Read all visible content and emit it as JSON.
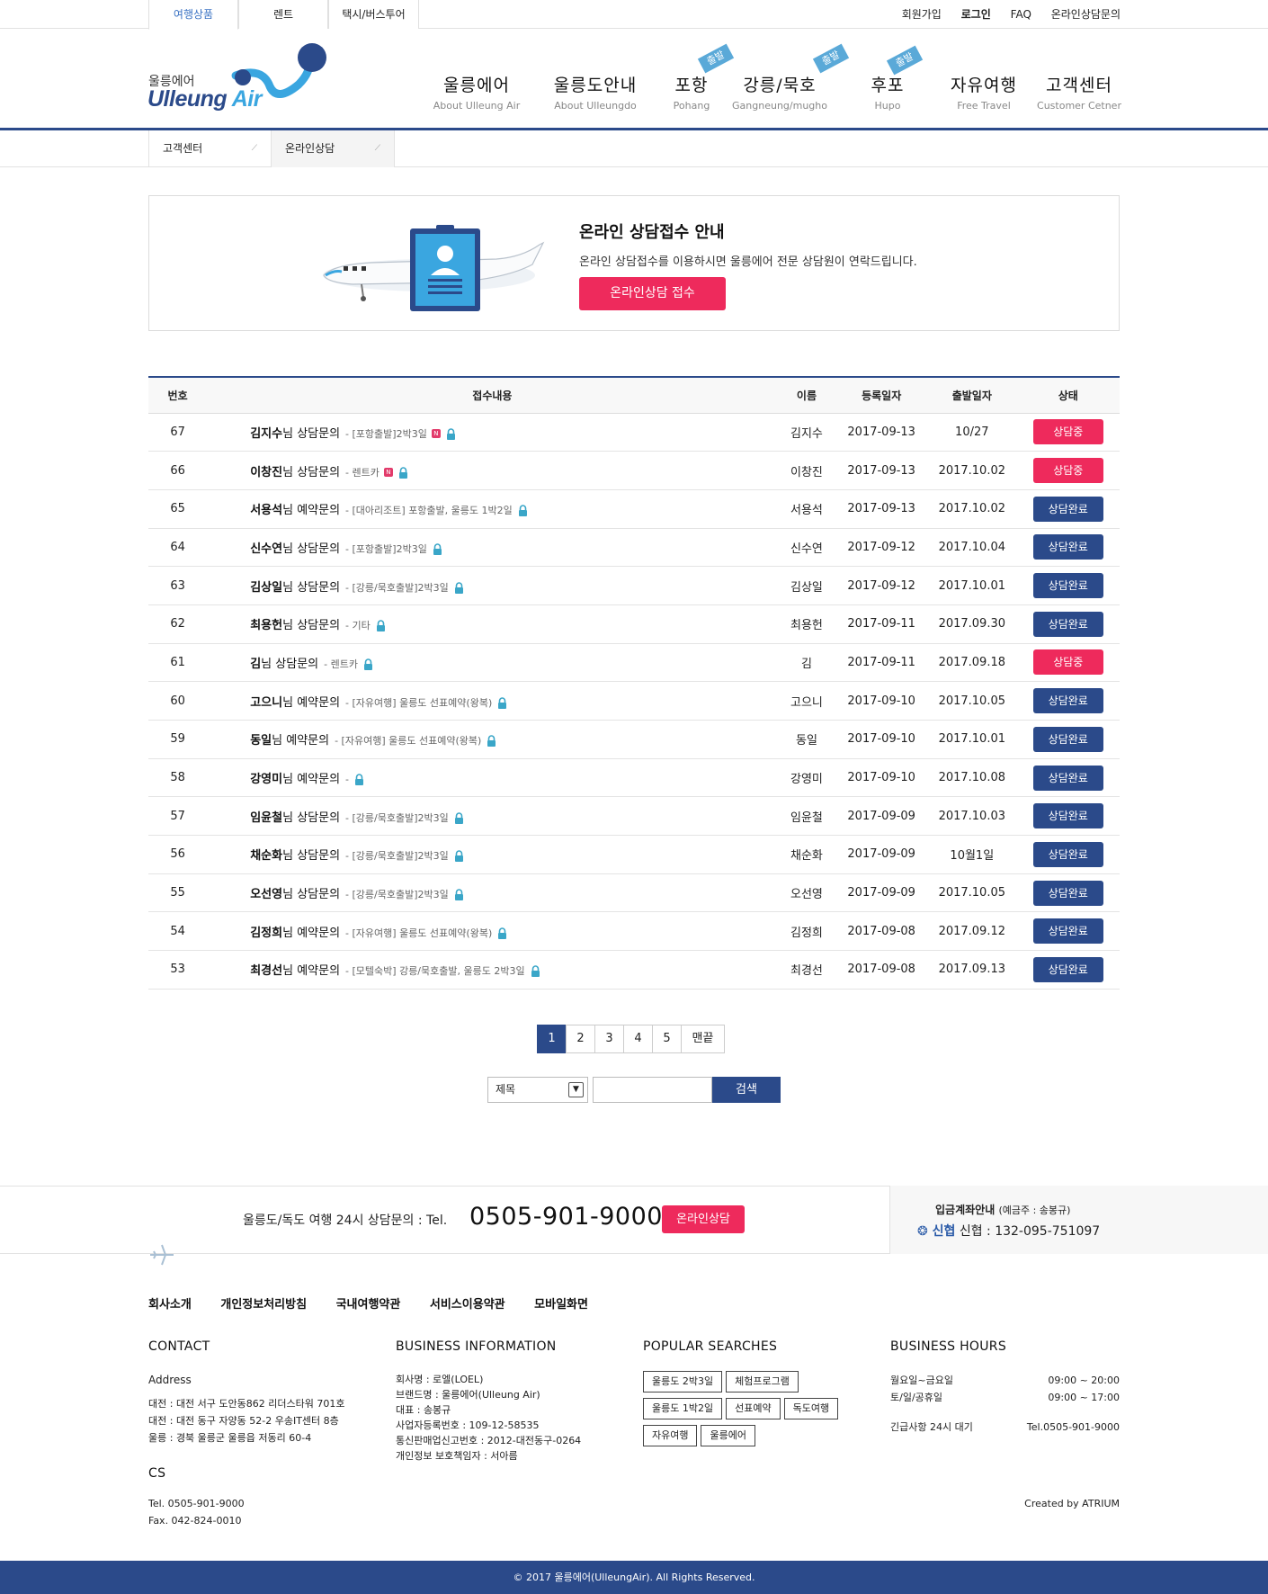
{
  "top": {
    "tabs": [
      "여행상품",
      "렌트",
      "택시/버스투어"
    ],
    "links": [
      "회원가입",
      "로그인",
      "FAQ",
      "온라인상담문의"
    ]
  },
  "logo": {
    "sub": "울릉에어",
    "main": "Ulleung",
    "air": "Air"
  },
  "nav": [
    {
      "k": "울릉에어",
      "e": "About Ulleung Air",
      "badge": ""
    },
    {
      "k": "울릉도안내",
      "e": "About Ulleungdo",
      "badge": ""
    },
    {
      "k": "포항",
      "e": "Pohang",
      "badge": "출발"
    },
    {
      "k": "강릉/묵호",
      "e": "Gangneung/mugho",
      "badge": "출발"
    },
    {
      "k": "후포",
      "e": "Hupo",
      "badge": "출발"
    },
    {
      "k": "자유여행",
      "e": "Free Travel",
      "badge": ""
    },
    {
      "k": "고객센터",
      "e": "Customer Cetner",
      "badge": ""
    }
  ],
  "subnav": [
    "고객센터",
    "온라인상담"
  ],
  "banner": {
    "title": "온라인 상담접수 안내",
    "desc": "온라인 상담접수를 이용하시면 울릉에어 전문 상담원이 연락드립니다.",
    "button": "온라인상담 접수"
  },
  "board": {
    "headers": [
      "번호",
      "접수내용",
      "이름",
      "등록일자",
      "출발일자",
      "상태"
    ],
    "rows": [
      {
        "no": "67",
        "name": "김지수",
        "suffix": "님",
        "kind": "상담문의",
        "cat": "- [포항출발]2박3일",
        "new": true,
        "user": "김지수",
        "reg": "2017-09-13",
        "dep": "10/27",
        "status": "상담중",
        "ing": true
      },
      {
        "no": "66",
        "name": "이창진",
        "suffix": "님",
        "kind": "상담문의",
        "cat": "- 렌트카",
        "new": true,
        "user": "이창진",
        "reg": "2017-09-13",
        "dep": "2017.10.02",
        "status": "상담중",
        "ing": true
      },
      {
        "no": "65",
        "name": "서용석",
        "suffix": "님",
        "kind": "예약문의",
        "cat": "- [대아리조트] 포항출발, 울릉도 1박2일",
        "new": false,
        "user": "서용석",
        "reg": "2017-09-13",
        "dep": "2017.10.02",
        "status": "상담완료",
        "ing": false
      },
      {
        "no": "64",
        "name": "신수연",
        "suffix": "님",
        "kind": "상담문의",
        "cat": "- [포항출발]2박3일",
        "new": false,
        "user": "신수연",
        "reg": "2017-09-12",
        "dep": "2017.10.04",
        "status": "상담완료",
        "ing": false
      },
      {
        "no": "63",
        "name": "김상일",
        "suffix": "님",
        "kind": "상담문의",
        "cat": "- [강릉/묵호출발]2박3일",
        "new": false,
        "user": "김상일",
        "reg": "2017-09-12",
        "dep": "2017.10.01",
        "status": "상담완료",
        "ing": false
      },
      {
        "no": "62",
        "name": "최용헌",
        "suffix": "님",
        "kind": "상담문의",
        "cat": "- 기타",
        "new": false,
        "user": "최용헌",
        "reg": "2017-09-11",
        "dep": "2017.09.30",
        "status": "상담완료",
        "ing": false
      },
      {
        "no": "61",
        "name": "김",
        "suffix": "님",
        "kind": "상담문의",
        "cat": "- 렌트카",
        "new": false,
        "user": "김",
        "reg": "2017-09-11",
        "dep": "2017.09.18",
        "status": "상담중",
        "ing": true
      },
      {
        "no": "60",
        "name": "고으니",
        "suffix": "님",
        "kind": "예약문의",
        "cat": "- [자유여행] 울릉도 선표예약(왕복)",
        "new": false,
        "user": "고으니",
        "reg": "2017-09-10",
        "dep": "2017.10.05",
        "status": "상담완료",
        "ing": false
      },
      {
        "no": "59",
        "name": "동일",
        "suffix": "님",
        "kind": "예약문의",
        "cat": "- [자유여행] 울릉도 선표예약(왕복)",
        "new": false,
        "user": "동일",
        "reg": "2017-09-10",
        "dep": "2017.10.01",
        "status": "상담완료",
        "ing": false
      },
      {
        "no": "58",
        "name": "강영미",
        "suffix": "님",
        "kind": "예약문의",
        "cat": "-",
        "new": false,
        "user": "강영미",
        "reg": "2017-09-10",
        "dep": "2017.10.08",
        "status": "상담완료",
        "ing": false
      },
      {
        "no": "57",
        "name": "임윤철",
        "suffix": "님",
        "kind": "상담문의",
        "cat": "- [강릉/묵호출발]2박3일",
        "new": false,
        "user": "임윤철",
        "reg": "2017-09-09",
        "dep": "2017.10.03",
        "status": "상담완료",
        "ing": false
      },
      {
        "no": "56",
        "name": "채순화",
        "suffix": "님",
        "kind": "상담문의",
        "cat": "- [강릉/묵호출발]2박3일",
        "new": false,
        "user": "채순화",
        "reg": "2017-09-09",
        "dep": "10월1일",
        "status": "상담완료",
        "ing": false
      },
      {
        "no": "55",
        "name": "오선영",
        "suffix": "님",
        "kind": "상담문의",
        "cat": "- [강릉/묵호출발]2박3일",
        "new": false,
        "user": "오선영",
        "reg": "2017-09-09",
        "dep": "2017.10.05",
        "status": "상담완료",
        "ing": false
      },
      {
        "no": "54",
        "name": "김정희",
        "suffix": "님",
        "kind": "예약문의",
        "cat": "- [자유여행] 울릉도 선표예약(왕복)",
        "new": false,
        "user": "김정희",
        "reg": "2017-09-08",
        "dep": "2017.09.12",
        "status": "상담완료",
        "ing": false
      },
      {
        "no": "53",
        "name": "최경선",
        "suffix": "님",
        "kind": "예약문의",
        "cat": "- [모텔숙박] 강릉/묵호출발, 울릉도 2박3일",
        "new": false,
        "user": "최경선",
        "reg": "2017-09-08",
        "dep": "2017.09.13",
        "status": "상담완료",
        "ing": false
      }
    ]
  },
  "pager": [
    "1",
    "2",
    "3",
    "4",
    "5",
    "맨끝"
  ],
  "search": {
    "select": "제목",
    "button": "검색"
  },
  "footer_bar": {
    "call": "울릉도/독도 여행 24시 상담문의 : Tel.",
    "number": "0505-901-9000",
    "button": "온라인상담",
    "bank_title": "입금계좌안내",
    "bank_owner": "(예금주 : 송봉규)",
    "bank_logo": "신협",
    "bank_account": "신협 : 132-095-751097"
  },
  "footer_links": [
    "회사소개",
    "개인정보처리방침",
    "국내여행약관",
    "서비스이용약관",
    "모바일화면"
  ],
  "contact": {
    "title": "CONTACT",
    "addr_label": "Address",
    "addr": [
      "대전 : 대전 서구 도안동862 리더스타워 701호",
      "대전 : 대전 동구 자양동 52-2 우송IT센터 8층",
      "울릉 : 경북 울릉군 울릉읍 저동리 60-4"
    ],
    "cs_title": "CS",
    "tel": "Tel. 0505-901-9000",
    "fax": "Fax. 042-824-0010"
  },
  "business": {
    "title": "BUSINESS INFORMATION",
    "lines": [
      "회사명 : 로엘(LOEL)",
      "브랜드명 : 울릉에어(Ulleung Air)",
      "대표 : 송봉규",
      "사업자등록번호 : 109-12-58535",
      "통신판매업신고번호 : 2012-대전동구-0264",
      "개인정보 보호책임자 : 서아름"
    ]
  },
  "popular": {
    "title": "POPULAR SEARCHES",
    "tags": [
      [
        "울릉도 2박3일",
        "체험프로그램"
      ],
      [
        "울릉도 1박2일",
        "선표예약",
        "독도여행"
      ],
      [
        "자유여행",
        "울릉에어"
      ]
    ]
  },
  "hours": {
    "title": "BUSINESS HOURS",
    "rows": [
      [
        "월요일~금요일",
        "09:00 ~ 20:00"
      ],
      [
        "토/일/공휴일",
        "09:00 ~ 17:00"
      ]
    ],
    "emergency": "긴급사항 24시 대기",
    "emergency_tel": "Tel.0505-901-9000",
    "created": "Created by ATRIUM"
  },
  "copyright": "© 2017 울릉에어(UlleungAir). All Rights Reserved.",
  "colors": {
    "brand": "#2b4a8a",
    "accent": "#ee2a5c",
    "sky": "#3aa6e0"
  }
}
